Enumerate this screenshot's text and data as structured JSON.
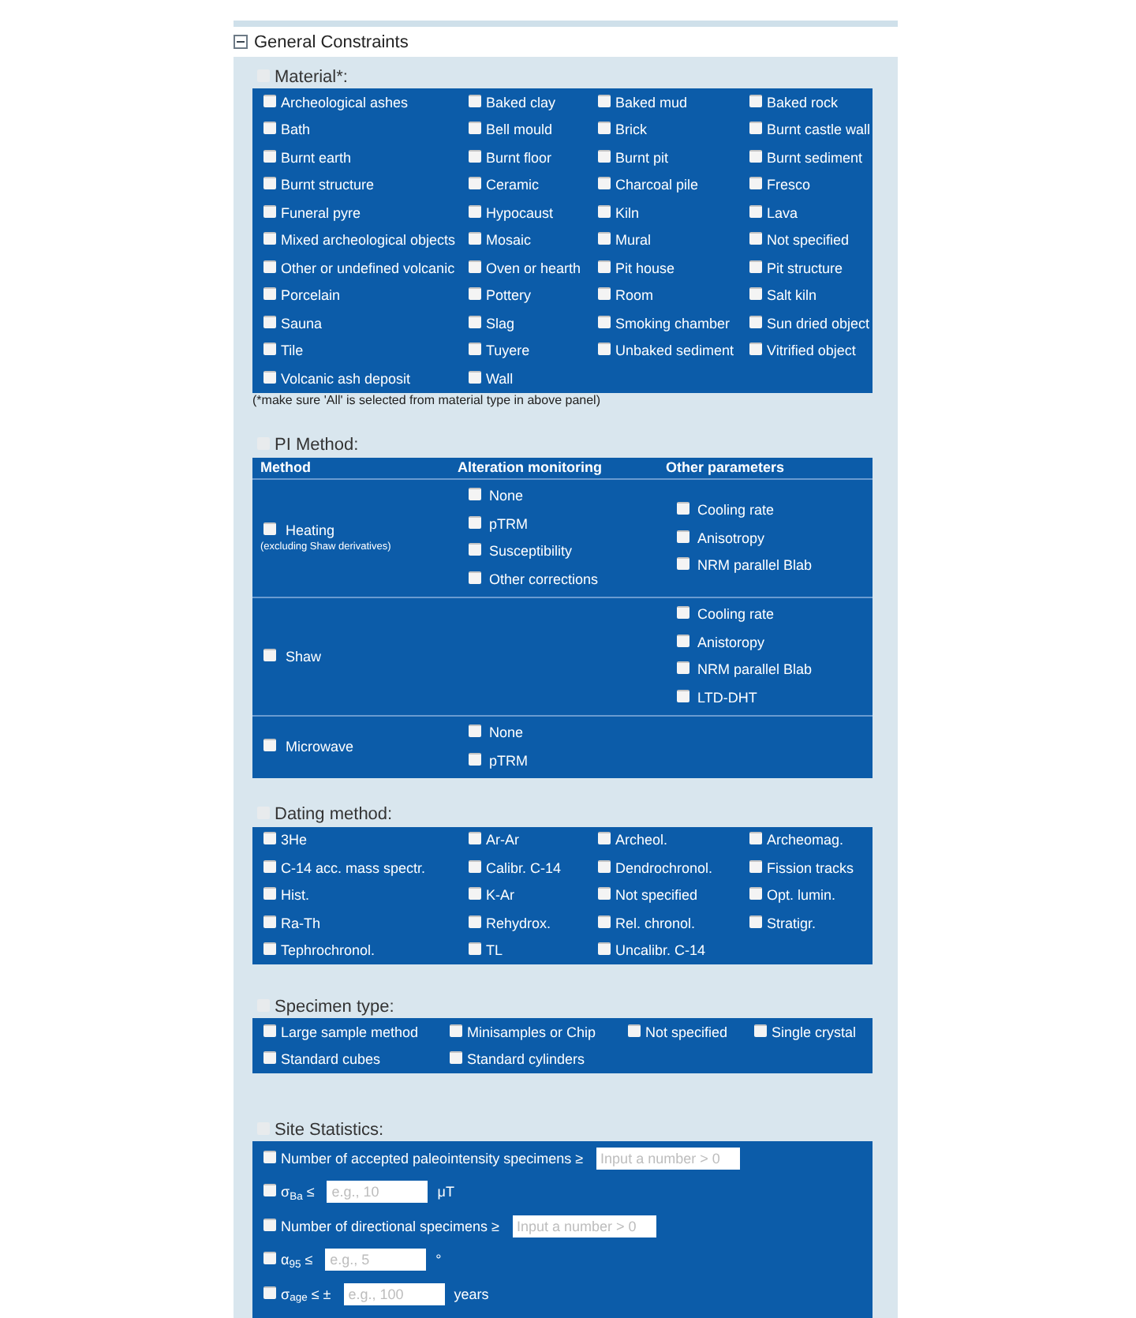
{
  "title": "General Constraints",
  "expanded": true,
  "material": {
    "label": "Material*:",
    "checked": false,
    "options": [
      {
        "label": "Archeological ashes",
        "checked": false
      },
      {
        "label": "Baked clay",
        "checked": false
      },
      {
        "label": "Baked mud",
        "checked": false
      },
      {
        "label": "Baked rock",
        "checked": false
      },
      {
        "label": "Bath",
        "checked": false
      },
      {
        "label": "Bell mould",
        "checked": false
      },
      {
        "label": "Brick",
        "checked": false
      },
      {
        "label": "Burnt castle wall",
        "checked": false
      },
      {
        "label": "Burnt earth",
        "checked": false
      },
      {
        "label": "Burnt floor",
        "checked": false
      },
      {
        "label": "Burnt pit",
        "checked": false
      },
      {
        "label": "Burnt sediment",
        "checked": false
      },
      {
        "label": "Burnt structure",
        "checked": false
      },
      {
        "label": "Ceramic",
        "checked": false
      },
      {
        "label": "Charcoal pile",
        "checked": false
      },
      {
        "label": "Fresco",
        "checked": false
      },
      {
        "label": "Funeral pyre",
        "checked": false
      },
      {
        "label": "Hypocaust",
        "checked": false
      },
      {
        "label": "Kiln",
        "checked": false
      },
      {
        "label": "Lava",
        "checked": false
      },
      {
        "label": "Mixed archeological objects",
        "checked": false
      },
      {
        "label": "Mosaic",
        "checked": false
      },
      {
        "label": "Mural",
        "checked": false
      },
      {
        "label": "Not specified",
        "checked": false
      },
      {
        "label": "Other or undefined volcanic",
        "checked": false
      },
      {
        "label": "Oven or hearth",
        "checked": false
      },
      {
        "label": "Pit house",
        "checked": false
      },
      {
        "label": "Pit structure",
        "checked": false
      },
      {
        "label": "Porcelain",
        "checked": false
      },
      {
        "label": "Pottery",
        "checked": false
      },
      {
        "label": "Room",
        "checked": false
      },
      {
        "label": "Salt kiln",
        "checked": false
      },
      {
        "label": "Sauna",
        "checked": false
      },
      {
        "label": "Slag",
        "checked": false
      },
      {
        "label": "Smoking chamber",
        "checked": false
      },
      {
        "label": "Sun dried object",
        "checked": false
      },
      {
        "label": "Tile",
        "checked": false
      },
      {
        "label": "Tuyere",
        "checked": false
      },
      {
        "label": "Unbaked sediment",
        "checked": false
      },
      {
        "label": "Vitrified object",
        "checked": false
      },
      {
        "label": "Volcanic ash deposit",
        "checked": false
      },
      {
        "label": "Wall",
        "checked": false
      }
    ],
    "note": "(*make sure 'All' is selected from material type in above panel)"
  },
  "pi_method": {
    "label": "PI Method:",
    "checked": false,
    "columns": [
      "Method",
      "Alteration monitoring",
      "Other parameters"
    ],
    "rows": [
      {
        "method": {
          "label": "Heating",
          "note": "(excluding Shaw derivatives)",
          "checked": false
        },
        "alteration_monitoring": [
          {
            "label": "None",
            "checked": false
          },
          {
            "label": "pTRM",
            "checked": false
          },
          {
            "label": "Susceptibility",
            "checked": false
          },
          {
            "label": "Other corrections",
            "checked": false
          }
        ],
        "other_parameters": [
          {
            "label": "Cooling rate",
            "checked": false
          },
          {
            "label": "Anisotropy",
            "checked": false
          },
          {
            "label": "NRM parallel Blab",
            "checked": false
          }
        ]
      },
      {
        "method": {
          "label": "Shaw",
          "checked": false
        },
        "other_parameters": [
          {
            "label": "Cooling rate",
            "checked": false
          },
          {
            "label": "Anistoropy",
            "checked": false
          },
          {
            "label": "NRM parallel Blab",
            "checked": false
          },
          {
            "label": "LTD-DHT",
            "checked": false
          }
        ]
      },
      {
        "method": {
          "label": "Microwave",
          "checked": false
        },
        "alteration_monitoring": [
          {
            "label": "None",
            "checked": false
          },
          {
            "label": "pTRM",
            "checked": false
          }
        ]
      }
    ]
  },
  "dating_method": {
    "label": "Dating method:",
    "checked": false,
    "options": [
      {
        "label": "3He",
        "checked": false
      },
      {
        "label": "Ar-Ar",
        "checked": false
      },
      {
        "label": "Archeol.",
        "checked": false
      },
      {
        "label": "Archeomag.",
        "checked": false
      },
      {
        "label": "C-14 acc. mass spectr.",
        "checked": false
      },
      {
        "label": "Calibr. C-14",
        "checked": false
      },
      {
        "label": "Dendrochronol.",
        "checked": false
      },
      {
        "label": "Fission tracks",
        "checked": false
      },
      {
        "label": "Hist.",
        "checked": false
      },
      {
        "label": "K-Ar",
        "checked": false
      },
      {
        "label": "Not specified",
        "checked": false
      },
      {
        "label": "Opt. lumin.",
        "checked": false
      },
      {
        "label": "Ra-Th",
        "checked": false
      },
      {
        "label": "Rehydrox.",
        "checked": false
      },
      {
        "label": "Rel. chronol.",
        "checked": false
      },
      {
        "label": "Stratigr.",
        "checked": false
      },
      {
        "label": "Tephrochronol.",
        "checked": false
      },
      {
        "label": "TL",
        "checked": false
      },
      {
        "label": "Uncalibr. C-14",
        "checked": false
      }
    ]
  },
  "specimen_type": {
    "label": "Specimen type:",
    "checked": false,
    "options": [
      {
        "label": "Large sample method",
        "checked": false
      },
      {
        "label": "Minisamples or Chip",
        "checked": false
      },
      {
        "label": "Not specified",
        "checked": false
      },
      {
        "label": "Single crystal",
        "checked": false
      },
      {
        "label": "Standard cubes",
        "checked": false
      },
      {
        "label": "Standard cylinders",
        "checked": false
      }
    ]
  },
  "site_statistics": {
    "label": "Site Statistics:",
    "checked": false,
    "rows": [
      {
        "kind": "count",
        "label": "Number of accepted paleointensity specimens ≥",
        "checked": false,
        "placeholder": "Input a number > 0"
      },
      {
        "kind": "bound",
        "label": "σ$_{Ba}$ ≤",
        "checked": false,
        "placeholder": "e.g., 10",
        "unit": "μT"
      },
      {
        "kind": "count",
        "label": "Number of directional specimens ≥",
        "checked": false,
        "placeholder": "Input a number > 0"
      },
      {
        "kind": "bound",
        "label": "α$_{95}$ ≤",
        "checked": false,
        "placeholder": "e.g., 5",
        "unit": "°"
      },
      {
        "kind": "bound",
        "label": "σ$_{age}$ ≤ ±",
        "checked": false,
        "placeholder": "e.g., 100",
        "unit": "years"
      }
    ]
  }
}
